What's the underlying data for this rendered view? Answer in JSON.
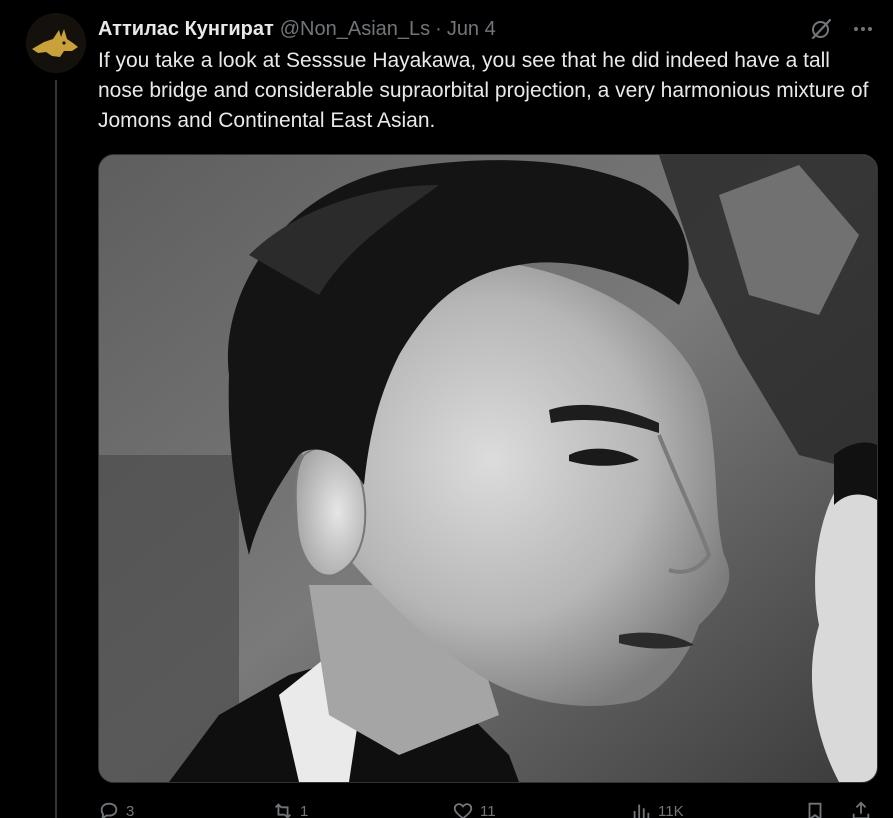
{
  "tweet": {
    "author": {
      "display_name": "Аттилас Кунгират",
      "handle": "@Non_Asian_Ls",
      "avatar_icon": "jackal-head-icon",
      "avatar_color": "#c9a13a"
    },
    "separator": "·",
    "date": "Jun 4",
    "text": "If you take a look at Sesssue Hayakawa, you see that he did indeed have a tall nose bridge and considerable supraorbital projection, a very harmonious mixture of Jomons and Continental East Asian.",
    "media": {
      "type": "black-and-white photo"
    },
    "header_icons": [
      "grok-icon",
      "more-icon"
    ],
    "actions": {
      "reply": {
        "icon": "reply-icon",
        "count": "3"
      },
      "repost": {
        "icon": "repost-icon",
        "count": "1"
      },
      "like": {
        "icon": "heart-icon",
        "count": "11"
      },
      "views": {
        "icon": "views-icon",
        "count": "11K"
      },
      "bookmark": {
        "icon": "bookmark-icon"
      },
      "share": {
        "icon": "share-icon"
      }
    }
  },
  "colors": {
    "background": "#000000",
    "primary_text": "#e7e9ea",
    "secondary_text": "#71767b",
    "divider": "#333639"
  }
}
